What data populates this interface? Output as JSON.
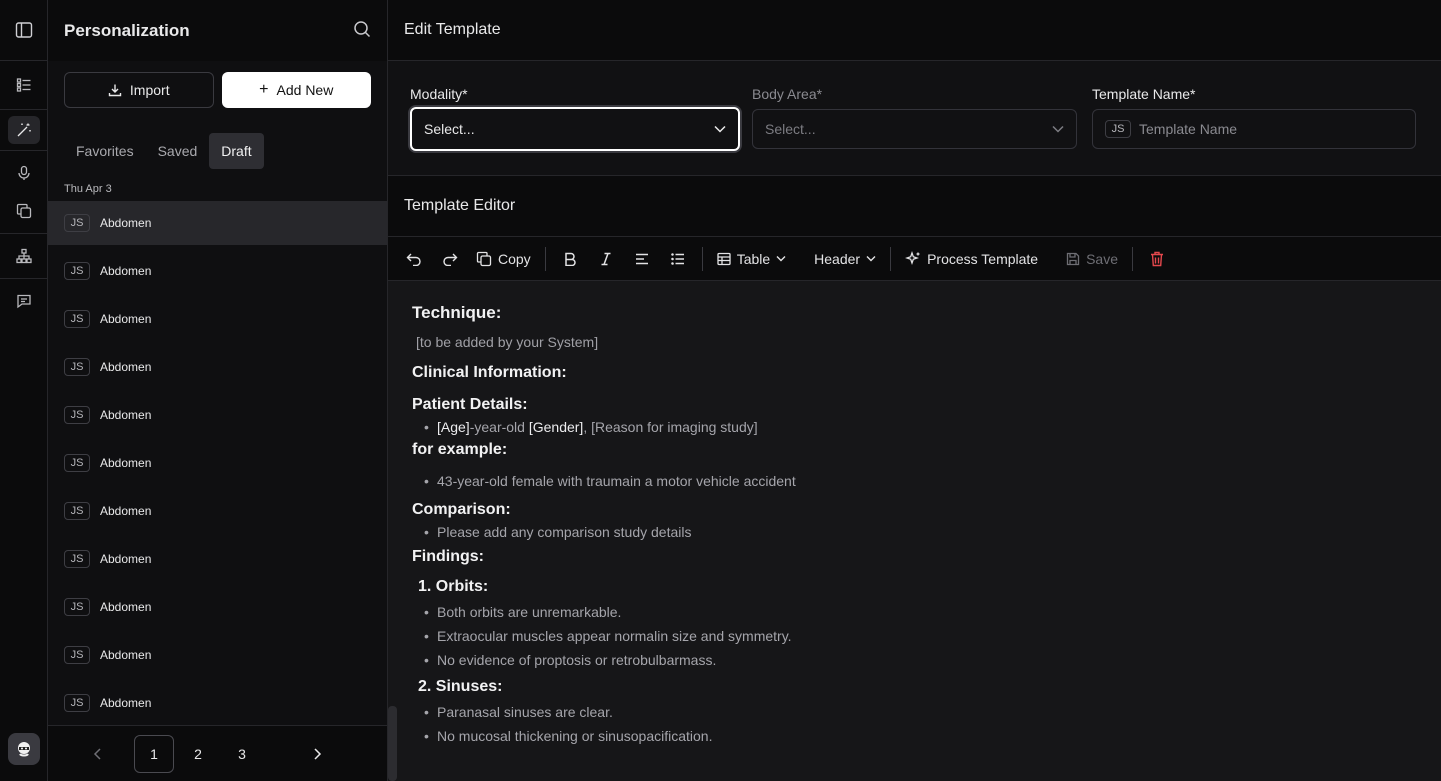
{
  "sidebar": {
    "title": "Personalization",
    "import_label": "Import",
    "add_new_label": "Add New",
    "tabs": [
      "Favorites",
      "Saved",
      "Draft"
    ],
    "date_group": "Thu Apr 3",
    "badge": "JS",
    "items": [
      "Abdomen",
      "Abdomen",
      "Abdomen",
      "Abdomen",
      "Abdomen",
      "Abdomen",
      "Abdomen",
      "Abdomen",
      "Abdomen",
      "Abdomen",
      "Abdomen"
    ],
    "pages": [
      "1",
      "2",
      "3"
    ]
  },
  "main": {
    "title": "Edit Template",
    "modality_label": "Modality*",
    "modality_value": "Select...",
    "body_area_label": "Body Area*",
    "body_area_value": "Select...",
    "template_name_label": "Template Name*",
    "template_name_placeholder": "Template Name",
    "template_name_badge": "JS",
    "editor_title": "Template Editor"
  },
  "toolbar": {
    "copy_label": "Copy",
    "table_label": "Table",
    "header_label": "Header",
    "process_label": "Process Template",
    "save_label": "Save"
  },
  "doc": {
    "technique_h": "Technique:",
    "technique_text": "[to be added by your System]",
    "clinical_h": "Clinical Information:",
    "patient_h": "Patient Details:",
    "patient_age": "[Age]",
    "patient_mid1": "-year-old ",
    "patient_gender": "[Gender]",
    "patient_rest": ", [Reason for imaging study]",
    "example_h": "for example:",
    "example_text": "43-year-old female with traumain a motor vehicle accident",
    "comparison_h": "Comparison:",
    "comparison_text": "Please add any comparison study details",
    "findings_h": "Findings:",
    "orbits_h": "1. Orbits:",
    "orbits": [
      "Both orbits are unremarkable.",
      "Extraocular muscles appear normalin size and symmetry.",
      "No evidence of proptosis or retrobulbarmass."
    ],
    "sinuses_h": "2. Sinuses:",
    "sinuses": [
      "Paranasal sinuses are clear.",
      "No mucosal thickening or sinusopacification."
    ]
  },
  "colors": {
    "accent": "#ffffff",
    "danger": "#e5484d",
    "background": "#0b0b0c"
  }
}
